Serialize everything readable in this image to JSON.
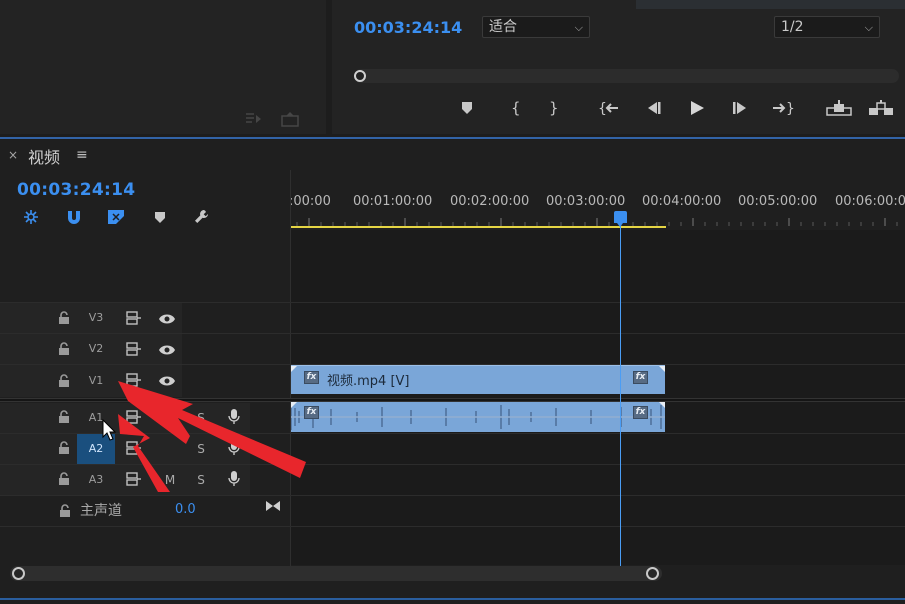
{
  "program_monitor": {
    "timecode": "00:03:24:14",
    "fit_select": "适合",
    "resolution_select": "1/2"
  },
  "timeline": {
    "tab_close": "×",
    "tab_title": "视频",
    "tab_menu": "≡",
    "timecode": "00:03:24:14",
    "ruler_labels": [
      ":00:00",
      "00:01:00:00",
      "00:02:00:00",
      "00:03:00:00",
      "00:04:00:00",
      "00:05:00:00",
      "00:06:00:00"
    ],
    "tracks": {
      "v3": "V3",
      "v2": "V2",
      "v1": "V1",
      "a1": "A1",
      "a2": "A2",
      "a3": "A3",
      "m": "M",
      "s": "S"
    },
    "video_clip_label": "视频.mp4 [V]",
    "fx": "fx",
    "master_label": "主声道",
    "master_value": "0.0"
  },
  "colors": {
    "accent": "#3b8ff0",
    "clip": "#7aa6d8",
    "work_area": "#e5d544",
    "annotation": "#e8262c"
  }
}
